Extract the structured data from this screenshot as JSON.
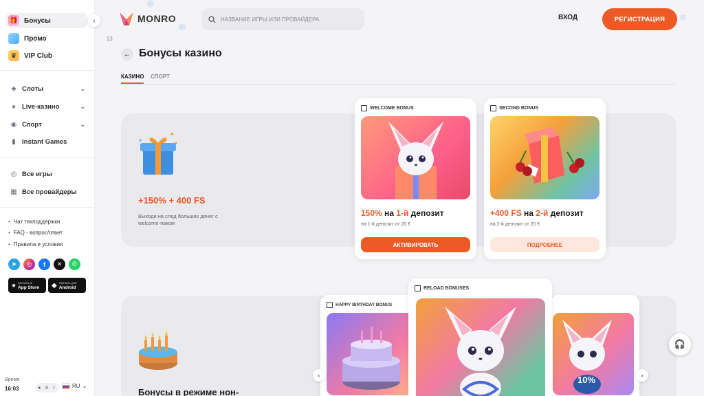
{
  "brand": {
    "name": "MONRO",
    "accent": "#ee5a26"
  },
  "sidebar": {
    "top_items": [
      {
        "label": "Бонусы",
        "icon": "gift-icon"
      },
      {
        "label": "Промо",
        "icon": "promo-icon",
        "badge": "13"
      },
      {
        "label": "VIP Club",
        "icon": "crown-icon"
      }
    ],
    "nav": [
      {
        "label": "Слоты",
        "icon": "slots-icon"
      },
      {
        "label": "Live-казино",
        "icon": "live-casino-icon"
      },
      {
        "label": "Спорт",
        "icon": "sport-icon"
      },
      {
        "label": "Instant Games",
        "icon": "chart-icon"
      }
    ],
    "catalog": [
      {
        "label": "Все игры",
        "icon": "games-icon"
      },
      {
        "label": "Все провайдеры",
        "icon": "grid-icon"
      }
    ],
    "links": [
      "Чат техподдержки",
      "FAQ - вопрос/ответ",
      "Правила и условия"
    ],
    "stores": [
      {
        "small": "Скачать в",
        "big": "App Store"
      },
      {
        "small": "Скачать для",
        "big": "Android"
      }
    ],
    "time_label": "Время",
    "time": "16:03",
    "theme_auto": "A",
    "lang": "RU"
  },
  "header": {
    "search_placeholder": "НАЗВАНИЕ ИГРЫ ИЛИ ПРОВАЙДЕРА",
    "login": "ВХОД",
    "register": "РЕГИСТРАЦИЯ"
  },
  "page": {
    "title": "Бонусы казино",
    "tabs": [
      "КАЗИНО",
      "СПОРТ"
    ]
  },
  "welcome_panel": {
    "amount": "+150% + 400 FS",
    "description": "Выходи на след больших денег с welcome-паком"
  },
  "cards": [
    {
      "label": "WELCOME BONUS",
      "head_accent": "150%",
      "head_mid": " на ",
      "head_accent2": "1-й",
      "head_end": " депозит",
      "sub": "на 1-й депозит от 20 €",
      "button": "АКТИВИРОВАТЬ"
    },
    {
      "label": "SECOND BONUS",
      "head_accent": "+400 FS",
      "head_mid": " на ",
      "head_accent2": "2-й",
      "head_end": " депозит",
      "sub": "на 2-й депозит от 20 €",
      "button": "ПОДРОБНЕЕ"
    }
  ],
  "nonstop_panel": {
    "title": "Бонусы в режиме нон-"
  },
  "carousel": [
    {
      "label": "HAPPY BIRTHDAY BONUS"
    },
    {
      "label": "RELOAD BONUSES"
    },
    {
      "badge": "10%"
    }
  ]
}
